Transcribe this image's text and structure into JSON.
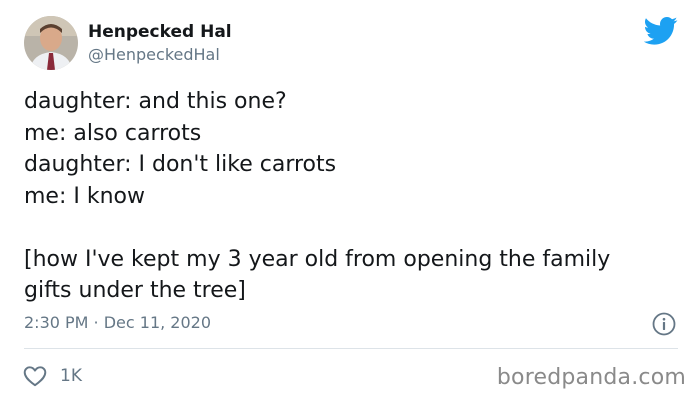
{
  "author": {
    "display_name": "Henpecked Hal",
    "handle": "@HenpeckedHal",
    "avatar": "profile-photo"
  },
  "tweet": {
    "lines": [
      "daughter: and this one?",
      "me: also carrots",
      "daughter: I don't like carrots",
      "me: I know",
      "",
      "[how I've kept my 3 year old from opening the family",
      "gifts under the tree]"
    ],
    "timestamp": "2:30 PM · Dec 11, 2020"
  },
  "actions": {
    "like_icon": "heart-icon",
    "like_count": "1K",
    "info_icon": "info-icon"
  },
  "branding": {
    "platform_icon": "twitter-bird-icon",
    "watermark": "boredpanda.com"
  },
  "colors": {
    "twitter_blue": "#1da1f2",
    "text_primary": "#14171a",
    "text_secondary": "#657786",
    "divider": "#dde3e8",
    "watermark": "#8a8a8a"
  }
}
